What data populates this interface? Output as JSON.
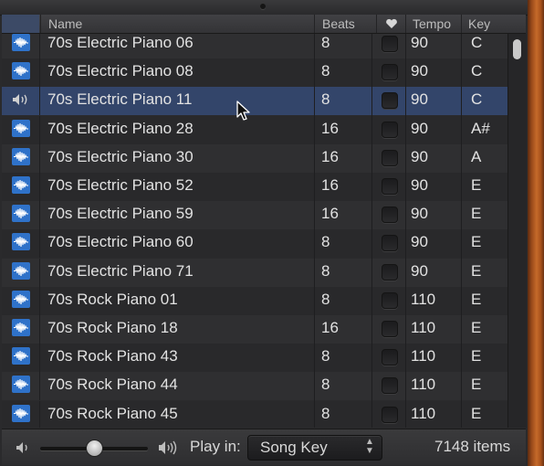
{
  "columns": {
    "name": "Name",
    "beats": "Beats",
    "favorite_icon": "heart-icon",
    "tempo": "Tempo",
    "key": "Key"
  },
  "rows": [
    {
      "name": "70s Electric Piano 06",
      "beats": "8",
      "tempo": "90",
      "key": "C",
      "state": "loop"
    },
    {
      "name": "70s Electric Piano 08",
      "beats": "8",
      "tempo": "90",
      "key": "C",
      "state": "loop"
    },
    {
      "name": "70s Electric Piano 11",
      "beats": "8",
      "tempo": "90",
      "key": "C",
      "state": "playing"
    },
    {
      "name": "70s Electric Piano 28",
      "beats": "16",
      "tempo": "90",
      "key": "A#",
      "state": "loop"
    },
    {
      "name": "70s Electric Piano 30",
      "beats": "16",
      "tempo": "90",
      "key": "A",
      "state": "loop"
    },
    {
      "name": "70s Electric Piano 52",
      "beats": "16",
      "tempo": "90",
      "key": "E",
      "state": "loop"
    },
    {
      "name": "70s Electric Piano 59",
      "beats": "16",
      "tempo": "90",
      "key": "E",
      "state": "loop"
    },
    {
      "name": "70s Electric Piano 60",
      "beats": "8",
      "tempo": "90",
      "key": "E",
      "state": "loop"
    },
    {
      "name": "70s Electric Piano 71",
      "beats": "8",
      "tempo": "90",
      "key": "E",
      "state": "loop"
    },
    {
      "name": "70s Rock Piano 01",
      "beats": "8",
      "tempo": "110",
      "key": "E",
      "state": "loop"
    },
    {
      "name": "70s Rock Piano 18",
      "beats": "16",
      "tempo": "110",
      "key": "E",
      "state": "loop"
    },
    {
      "name": "70s Rock Piano 43",
      "beats": "8",
      "tempo": "110",
      "key": "E",
      "state": "loop"
    },
    {
      "name": "70s Rock Piano 44",
      "beats": "8",
      "tempo": "110",
      "key": "E",
      "state": "loop"
    },
    {
      "name": "70s Rock Piano 45",
      "beats": "8",
      "tempo": "110",
      "key": "E",
      "state": "loop"
    }
  ],
  "selected_row": 2,
  "footer": {
    "volume_level": 0.5,
    "play_in_label": "Play in:",
    "play_in_value": "Song Key",
    "item_count": "7148 items"
  },
  "colors": {
    "selection": "#33456a",
    "loop_icon": "#2f72c9",
    "wood": "#c56a2a"
  }
}
